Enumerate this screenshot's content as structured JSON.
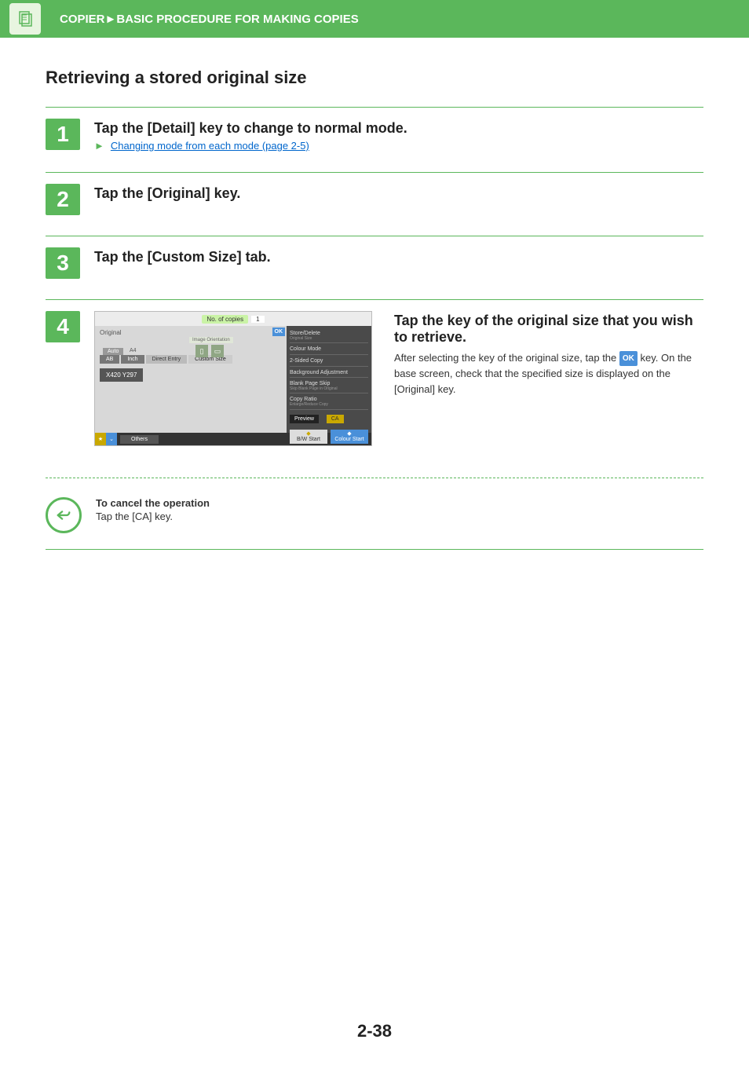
{
  "header": {
    "breadcrumb_section": "COPIER",
    "breadcrumb_sep": "►",
    "breadcrumb_page": "BASIC PROCEDURE FOR MAKING COPIES"
  },
  "title": "Retrieving a stored original size",
  "steps": {
    "s1": {
      "num": "1",
      "heading": "Tap the [Detail] key to change to normal mode.",
      "link_arrow": "►",
      "link_text": "Changing mode from each mode (page 2-5)"
    },
    "s2": {
      "num": "2",
      "heading": "Tap the [Original] key."
    },
    "s3": {
      "num": "3",
      "heading": "Tap the [Custom Size] tab."
    },
    "s4": {
      "num": "4",
      "heading": "Tap the key of the original size that you wish to retrieve.",
      "desc_a": "After selecting the key of the original size, tap the ",
      "desc_ok": "OK",
      "desc_b": " key. On the base screen, check that the specified size is displayed on the [Original] key."
    }
  },
  "screenshot": {
    "copies_label": "No. of copies",
    "copies_value": "1",
    "panel_title": "Original",
    "ok": "OK",
    "orient_label": "Image Orientation",
    "auto": "Auto",
    "a4": "A4",
    "tabs": {
      "ab": "AB",
      "inch": "Inch",
      "direct": "Direct Entry",
      "custom": "Custom Size"
    },
    "stored_size": "X420 Y297",
    "sidebar": {
      "store_delete": "Store/Delete",
      "store_delete_sub": "Original Size",
      "colour_mode": "Colour Mode",
      "two_sided": "2-Sided Copy",
      "background": "Background Adjustment",
      "blank_skip": "Blank Page Skip",
      "blank_skip_sub": "Skip Blank Page in Original",
      "copy_ratio": "Copy Ratio",
      "copy_ratio_sub": "Enlarge/Reduce Copy",
      "preview": "Preview",
      "ca": "CA",
      "bw": "B/W",
      "bw_sub": "Start",
      "colour": "Colour",
      "colour_sub": "Start"
    },
    "bottom": {
      "others": "Others"
    }
  },
  "note": {
    "title": "To cancel the operation",
    "text": "Tap the [CA] key."
  },
  "page_number": "2-38"
}
